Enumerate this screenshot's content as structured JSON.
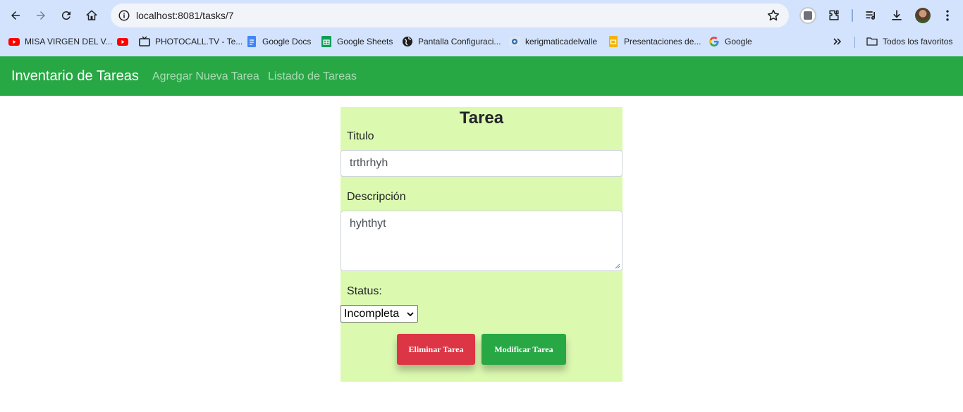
{
  "browser": {
    "url": "localhost:8081/tasks/7",
    "bookmarks": [
      {
        "label": "MISA VIRGEN DEL V...",
        "icon": "youtube-icon"
      },
      {
        "label": "",
        "icon": "youtube-icon"
      },
      {
        "label": "PHOTOCALL.TV - Te...",
        "icon": "tv-icon"
      },
      {
        "label": "Google Docs",
        "icon": "google-docs-icon"
      },
      {
        "label": "Google Sheets",
        "icon": "google-sheets-icon"
      },
      {
        "label": "Pantalla Configuraci...",
        "icon": "globe-icon"
      },
      {
        "label": "kerigmaticadelvalle",
        "icon": "site-icon"
      },
      {
        "label": "Presentaciones de...",
        "icon": "google-slides-icon"
      },
      {
        "label": "Google",
        "icon": "google-icon"
      }
    ],
    "all_bookmarks_label": "Todos los favoritos"
  },
  "navbar": {
    "brand": "Inventario de Tareas",
    "links": [
      "Agregar Nueva Tarea",
      "Listado de Tareas"
    ],
    "color": "#28a745"
  },
  "form": {
    "heading": "Tarea",
    "title_label": "Titulo",
    "title_value": "trthrhyh",
    "description_label": "Descripción",
    "description_value": "hyhthyt",
    "status_label": "Status:",
    "status_value": "Incompleta",
    "delete_button": "Eliminar Tarea",
    "update_button": "Modificar Tarea",
    "background": "#dcf9b0"
  }
}
